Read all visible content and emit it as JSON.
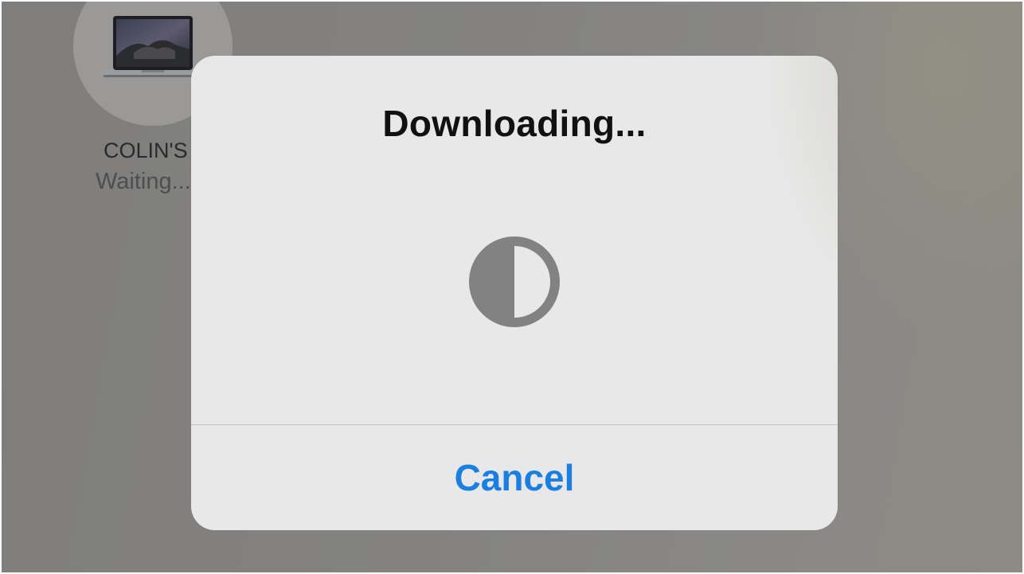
{
  "background_device": {
    "name": "COLIN'S",
    "status": "Waiting..."
  },
  "dialog": {
    "title": "Downloading...",
    "progress_fraction": 0.5,
    "cancel_label": "Cancel"
  },
  "colors": {
    "accent": "#1a7fe0",
    "dialog_background": "#e8e8e8",
    "progress_gray": "#828282"
  },
  "icons": {
    "device": "laptop-icon",
    "progress": "progress-ring-icon"
  }
}
